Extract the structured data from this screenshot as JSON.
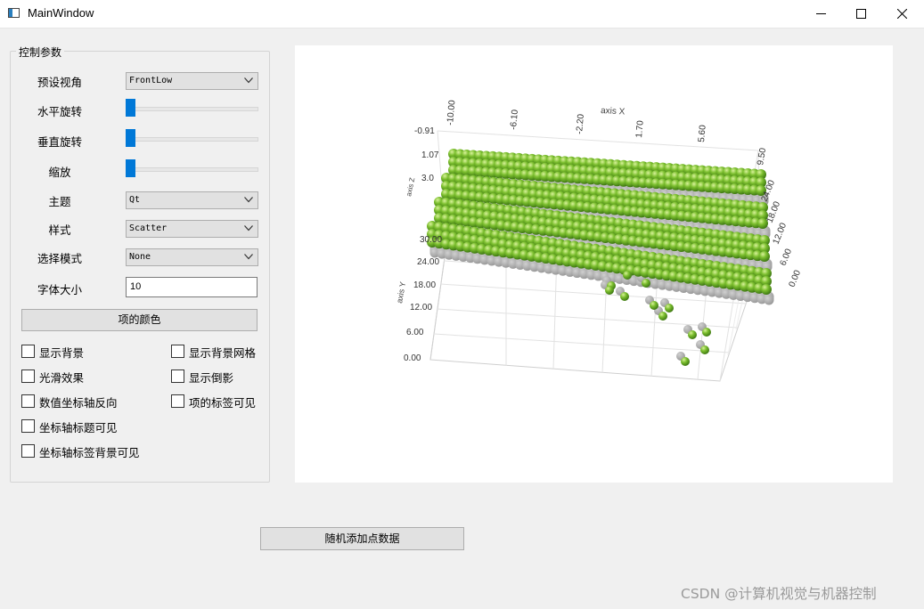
{
  "window": {
    "title": "MainWindow"
  },
  "controls": {
    "group_title": "控制参数",
    "preset_view": {
      "label": "预设视角",
      "value": "FrontLow"
    },
    "horizontal_rotation": {
      "label": "水平旋转",
      "level": 0
    },
    "vertical_rotation": {
      "label": "垂直旋转",
      "level": 0
    },
    "zoom": {
      "label": "缩放",
      "level": 0
    },
    "theme": {
      "label": "主题",
      "value": "Qt"
    },
    "style": {
      "label": "样式",
      "value": "Scatter"
    },
    "selection_mode": {
      "label": "选择模式",
      "value": "None"
    },
    "font_size": {
      "label": "字体大小",
      "value": "10"
    },
    "item_color_button": "项的颜色",
    "checkboxes": {
      "show_background": "显示背景",
      "show_background_grid": "显示背景网格",
      "smooth": "光滑效果",
      "show_shadow": "显示倒影",
      "reverse_value_axis": "数值坐标轴反向",
      "item_label_visible": "项的标签可见",
      "axis_title_visible": "坐标轴标题可见",
      "axis_label_background_visible": "坐标轴标签背景可见"
    }
  },
  "add_points_button": "随机添加点数据",
  "watermark": "CSDN @计算机视觉与机器控制",
  "chart_data": {
    "type": "scatter",
    "series_color": "#7cbf2f",
    "shadow_color": "#9a9a9a",
    "axis_x": {
      "title": "axis X",
      "ticks": [
        "-10.00",
        "-6.10",
        "-2.20",
        "1.70",
        "5.60",
        "9.50"
      ]
    },
    "axis_y": {
      "title": "axis Y",
      "ticks": [
        "0.00",
        "6.00",
        "12.00",
        "18.00",
        "24.00",
        "30.00"
      ]
    },
    "axis_z": {
      "title": "axis Z",
      "ticks_left": [
        "-0.91",
        "1.07",
        "3.0"
      ],
      "ticks_right": [
        "0.00",
        "6.00",
        "12.00",
        "18.00",
        "24.00"
      ]
    },
    "grid": true
  }
}
